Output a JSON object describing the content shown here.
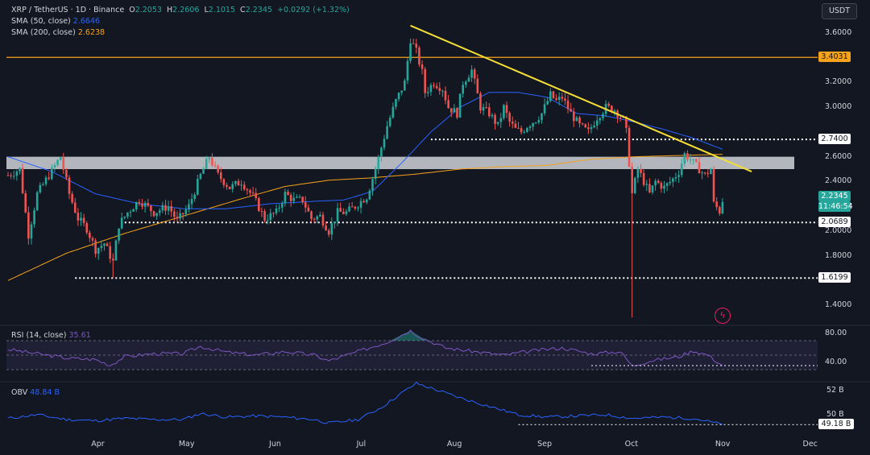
{
  "header": {
    "symbol": "XRP / TetherUS · 1D · Binance",
    "ohlc": [
      {
        "k": "O",
        "v": "2.2053"
      },
      {
        "k": "H",
        "v": "2.2606"
      },
      {
        "k": "L",
        "v": "2.1015"
      },
      {
        "k": "C",
        "v": "2.2345"
      },
      {
        "k": "",
        "v": "+0.0292 (+1.32%)"
      }
    ],
    "sma50_label": "SMA (50, close)",
    "sma50_value": "2.6646",
    "sma200_label": "SMA (200, close)",
    "sma200_value": "2.6238",
    "currency": "USDT"
  },
  "rsi_panel": {
    "label": "RSI (14, close)",
    "value": "35.61"
  },
  "obv_panel": {
    "label": "OBV",
    "value": "48.84 B"
  },
  "colors": {
    "background": "#131722",
    "up": "#26a69a",
    "down": "#ef5350",
    "sma50": "#2962ff",
    "sma200": "#f7a21b",
    "trendline": "#f5de35",
    "resistance": "#f7a21b",
    "zone": "#d0d3d8",
    "rsi": "#7e57c2",
    "obv": "#2962ff"
  },
  "chart_data": [
    {
      "type": "candlestick",
      "ylim": [
        1.3,
        3.75
      ],
      "y_ticks": [
        "3.6000",
        "3.2000",
        "3.0000",
        "2.6000",
        "2.4000",
        "2.0000",
        "1.8000",
        "1.4000"
      ],
      "x_ticks": [
        "Apr",
        "May",
        "Jun",
        "Jul",
        "Aug",
        "Sep",
        "Oct",
        "Nov",
        "Dec"
      ],
      "month_index": {
        "Apr": 31,
        "May": 61,
        "Jun": 92,
        "Jul": 122,
        "Aug": 153,
        "Sep": 184,
        "Oct": 214,
        "Nov": 245,
        "Dec": 275
      },
      "close_anchors": [
        [
          0,
          2.45
        ],
        [
          4,
          2.5
        ],
        [
          7,
          1.97
        ],
        [
          10,
          2.3
        ],
        [
          14,
          2.45
        ],
        [
          18,
          2.6
        ],
        [
          21,
          2.3
        ],
        [
          24,
          2.1
        ],
        [
          27,
          2.02
        ],
        [
          30,
          1.85
        ],
        [
          33,
          1.9
        ],
        [
          36,
          1.75
        ],
        [
          38,
          2.05
        ],
        [
          41,
          2.15
        ],
        [
          45,
          2.25
        ],
        [
          50,
          2.15
        ],
        [
          55,
          2.2
        ],
        [
          58,
          2.08
        ],
        [
          62,
          2.2
        ],
        [
          66,
          2.45
        ],
        [
          69,
          2.6
        ],
        [
          72,
          2.45
        ],
        [
          76,
          2.35
        ],
        [
          80,
          2.4
        ],
        [
          84,
          2.28
        ],
        [
          88,
          2.1
        ],
        [
          92,
          2.15
        ],
        [
          95,
          2.3
        ],
        [
          98,
          2.25
        ],
        [
          101,
          2.25
        ],
        [
          104,
          2.1
        ],
        [
          107,
          2.12
        ],
        [
          110,
          2.0
        ],
        [
          113,
          2.15
        ],
        [
          116,
          2.15
        ],
        [
          119,
          2.2
        ],
        [
          123,
          2.28
        ],
        [
          126,
          2.5
        ],
        [
          130,
          2.85
        ],
        [
          133,
          3.05
        ],
        [
          136,
          3.2
        ],
        [
          138,
          3.55
        ],
        [
          140,
          3.45
        ],
        [
          142,
          3.28
        ],
        [
          143,
          3.12
        ],
        [
          146,
          3.2
        ],
        [
          149,
          3.15
        ],
        [
          151,
          3.0
        ],
        [
          154,
          2.95
        ],
        [
          156,
          3.2
        ],
        [
          159,
          3.3
        ],
        [
          162,
          3.0
        ],
        [
          165,
          2.95
        ],
        [
          168,
          2.85
        ],
        [
          170,
          3.0
        ],
        [
          172,
          2.88
        ],
        [
          174,
          2.82
        ],
        [
          176,
          2.8
        ],
        [
          178,
          2.85
        ],
        [
          181,
          2.9
        ],
        [
          183,
          2.95
        ],
        [
          186,
          3.1
        ],
        [
          188,
          3.05
        ],
        [
          190,
          3.08
        ],
        [
          193,
          2.95
        ],
        [
          196,
          2.85
        ],
        [
          199,
          2.8
        ],
        [
          202,
          2.92
        ],
        [
          205,
          3.0
        ],
        [
          208,
          2.98
        ],
        [
          211,
          2.9
        ],
        [
          212,
          2.8
        ],
        [
          214,
          2.3
        ],
        [
          216,
          2.5
        ],
        [
          218,
          2.4
        ],
        [
          220,
          2.3
        ],
        [
          222,
          2.4
        ],
        [
          225,
          2.35
        ],
        [
          228,
          2.42
        ],
        [
          230,
          2.48
        ],
        [
          232,
          2.62
        ],
        [
          234,
          2.58
        ],
        [
          235,
          2.55
        ],
        [
          237,
          2.5
        ],
        [
          239,
          2.45
        ],
        [
          241,
          2.5
        ],
        [
          242,
          2.22
        ],
        [
          244,
          2.16
        ],
        [
          245,
          2.2345
        ]
      ],
      "sma50_anchors": [
        [
          0,
          2.6
        ],
        [
          15,
          2.48
        ],
        [
          30,
          2.3
        ],
        [
          45,
          2.22
        ],
        [
          60,
          2.18
        ],
        [
          75,
          2.18
        ],
        [
          90,
          2.22
        ],
        [
          105,
          2.24
        ],
        [
          115,
          2.25
        ],
        [
          125,
          2.32
        ],
        [
          135,
          2.55
        ],
        [
          145,
          2.8
        ],
        [
          155,
          3.0
        ],
        [
          165,
          3.12
        ],
        [
          175,
          3.12
        ],
        [
          185,
          3.08
        ],
        [
          195,
          2.95
        ],
        [
          205,
          2.93
        ],
        [
          215,
          2.88
        ],
        [
          225,
          2.82
        ],
        [
          235,
          2.75
        ],
        [
          245,
          2.66
        ]
      ],
      "sma200_anchors": [
        [
          0,
          1.6
        ],
        [
          20,
          1.82
        ],
        [
          40,
          1.98
        ],
        [
          60,
          2.12
        ],
        [
          80,
          2.26
        ],
        [
          95,
          2.36
        ],
        [
          110,
          2.41
        ],
        [
          125,
          2.43
        ],
        [
          140,
          2.46
        ],
        [
          155,
          2.5
        ],
        [
          170,
          2.52
        ],
        [
          185,
          2.53
        ],
        [
          200,
          2.58
        ],
        [
          215,
          2.6
        ],
        [
          230,
          2.61
        ],
        [
          245,
          2.62
        ]
      ],
      "levels": [
        {
          "price": 3.4031,
          "label": "3.4031",
          "style": "resistance",
          "from": 0
        },
        {
          "price": 2.74,
          "label": "2.7400",
          "style": "dotted",
          "from": 145
        },
        {
          "price": 2.0689,
          "label": "2.0689",
          "style": "dotted",
          "from": 40
        },
        {
          "price": 1.6199,
          "label": "1.6199",
          "style": "dotted",
          "from": 23
        }
      ],
      "zone": [
        2.5,
        2.6
      ],
      "trendline": [
        [
          138,
          3.66
        ],
        [
          255,
          2.48
        ]
      ],
      "wick_extremes": [
        [
          36,
          1.62
        ],
        [
          214,
          1.3
        ]
      ],
      "current": {
        "price": 2.2345,
        "label": "2.2345",
        "countdown": "11:46:54"
      }
    },
    {
      "type": "line",
      "name": "RSI (14, close)",
      "ylim": [
        25,
        85
      ],
      "y_ticks": [
        "80.00",
        "40.00"
      ],
      "band": [
        30,
        70
      ],
      "values_anchors": [
        [
          0,
          58
        ],
        [
          10,
          52
        ],
        [
          20,
          46
        ],
        [
          30,
          44
        ],
        [
          35,
          36
        ],
        [
          40,
          48
        ],
        [
          50,
          52
        ],
        [
          60,
          52
        ],
        [
          66,
          62
        ],
        [
          75,
          54
        ],
        [
          85,
          50
        ],
        [
          95,
          55
        ],
        [
          105,
          50
        ],
        [
          110,
          42
        ],
        [
          120,
          55
        ],
        [
          130,
          68
        ],
        [
          138,
          84
        ],
        [
          142,
          74
        ],
        [
          150,
          60
        ],
        [
          160,
          55
        ],
        [
          170,
          50
        ],
        [
          180,
          56
        ],
        [
          190,
          60
        ],
        [
          200,
          52
        ],
        [
          210,
          55
        ],
        [
          214,
          35
        ],
        [
          220,
          42
        ],
        [
          230,
          48
        ],
        [
          235,
          56
        ],
        [
          240,
          50
        ],
        [
          245,
          35.61
        ]
      ],
      "level_line": 35.61
    },
    {
      "type": "line",
      "name": "OBV",
      "unit": "B",
      "ylim": [
        48.6,
        53.2
      ],
      "y_ticks": [
        "52 B",
        "50 B"
      ],
      "values_anchors": [
        [
          0,
          49.7
        ],
        [
          10,
          50.0
        ],
        [
          20,
          49.6
        ],
        [
          30,
          49.5
        ],
        [
          40,
          49.7
        ],
        [
          50,
          49.6
        ],
        [
          60,
          49.6
        ],
        [
          66,
          50.1
        ],
        [
          75,
          49.8
        ],
        [
          85,
          49.9
        ],
        [
          95,
          49.8
        ],
        [
          105,
          49.6
        ],
        [
          110,
          49.3
        ],
        [
          120,
          49.6
        ],
        [
          128,
          50.6
        ],
        [
          135,
          51.8
        ],
        [
          140,
          52.6
        ],
        [
          145,
          52.2
        ],
        [
          155,
          51.4
        ],
        [
          165,
          50.7
        ],
        [
          175,
          50.0
        ],
        [
          185,
          49.8
        ],
        [
          195,
          49.9
        ],
        [
          205,
          50.0
        ],
        [
          214,
          49.7
        ],
        [
          225,
          49.8
        ],
        [
          235,
          49.7
        ],
        [
          245,
          49.2
        ]
      ],
      "current": {
        "value": 49.18,
        "label": "49.18 B"
      }
    }
  ]
}
